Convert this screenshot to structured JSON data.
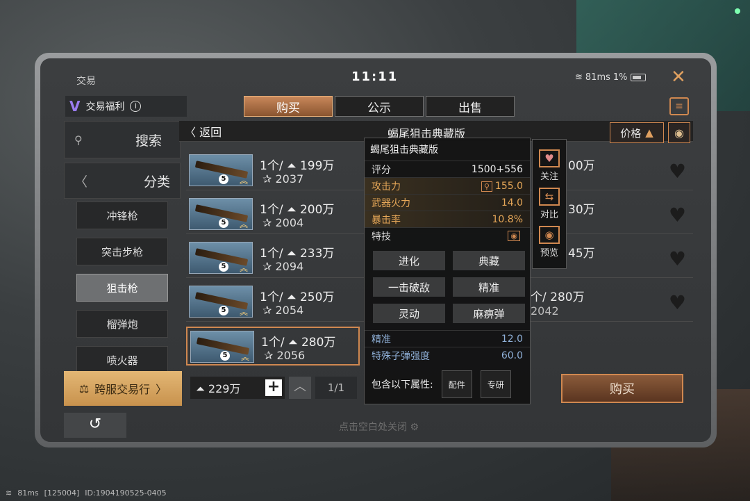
{
  "background": {
    "accent": "#d08850",
    "bottom_status": {
      "ping": "81ms",
      "server": "[125004]",
      "id": "ID:1904190525-0405"
    }
  },
  "topbar": {
    "title": "交易",
    "clock": "11:11",
    "ping": "81ms",
    "battery": "1%",
    "close_label": "✕"
  },
  "welfare": {
    "logo": "V",
    "label": "交易福利",
    "info_icon": "i"
  },
  "tabs": [
    {
      "label": "购买",
      "active": true
    },
    {
      "label": "公示",
      "active": false
    },
    {
      "label": "出售",
      "active": false
    }
  ],
  "sidebar": {
    "search_label": "搜索",
    "category_label": "分类",
    "categories": [
      {
        "label": "冲锋枪",
        "active": false
      },
      {
        "label": "突击步枪",
        "active": false
      },
      {
        "label": "狙击枪",
        "active": true
      },
      {
        "label": "榴弹炮",
        "active": false
      },
      {
        "label": "喷火器",
        "active": false
      }
    ],
    "cross_server_label": "跨服交易行"
  },
  "header": {
    "back_label": "返回",
    "item_title": "蝎尾狙击典藏版",
    "sort_label": "价格"
  },
  "listings": [
    {
      "qty": "1个/",
      "price": "199万",
      "score": "2037",
      "selected": false
    },
    {
      "qty": "1个/",
      "price": "200万",
      "score": "2004",
      "selected": false
    },
    {
      "qty": "1个/",
      "price": "233万",
      "score": "2094",
      "selected": false
    },
    {
      "qty": "1个/",
      "price": "250万",
      "score": "2054",
      "selected": false
    },
    {
      "qty": "1个/",
      "price": "280万",
      "score": "2056",
      "selected": true
    }
  ],
  "listing_partial": [
    {
      "price_tail": "00万"
    },
    {
      "price_tail": "30万"
    },
    {
      "price_tail": "45万"
    },
    {
      "price_full": "个/  280万",
      "score": "2042"
    }
  ],
  "bottom": {
    "balance": "229万",
    "plus": "+",
    "page": "1/1",
    "buy_label": "购买",
    "hint": "点击空白处关闭"
  },
  "popup": {
    "title": "蝎尾狙击典藏版",
    "rating_label": "评分",
    "rating_value": "1500+556",
    "attack_label": "攻击力",
    "attack_value": "155.0",
    "firepower_label": "武器火力",
    "firepower_value": "14.0",
    "crit_label": "暴击率",
    "crit_value": "10.8%",
    "skill_label": "特技",
    "skills": [
      "进化",
      "典藏",
      "一击破敌",
      "精准",
      "灵动",
      "麻痹弹"
    ],
    "precision_label": "精准",
    "precision_value": "12.0",
    "bullet_label": "特殊子弹强度",
    "bullet_value": "60.0",
    "contains_label": "包含以下属性:",
    "attr_buttons": [
      "配件",
      "专研"
    ]
  },
  "side_actions": [
    {
      "label": "关注",
      "icon": "heart-icon"
    },
    {
      "label": "对比",
      "icon": "compare-icon"
    },
    {
      "label": "预览",
      "icon": "eye-icon"
    }
  ]
}
